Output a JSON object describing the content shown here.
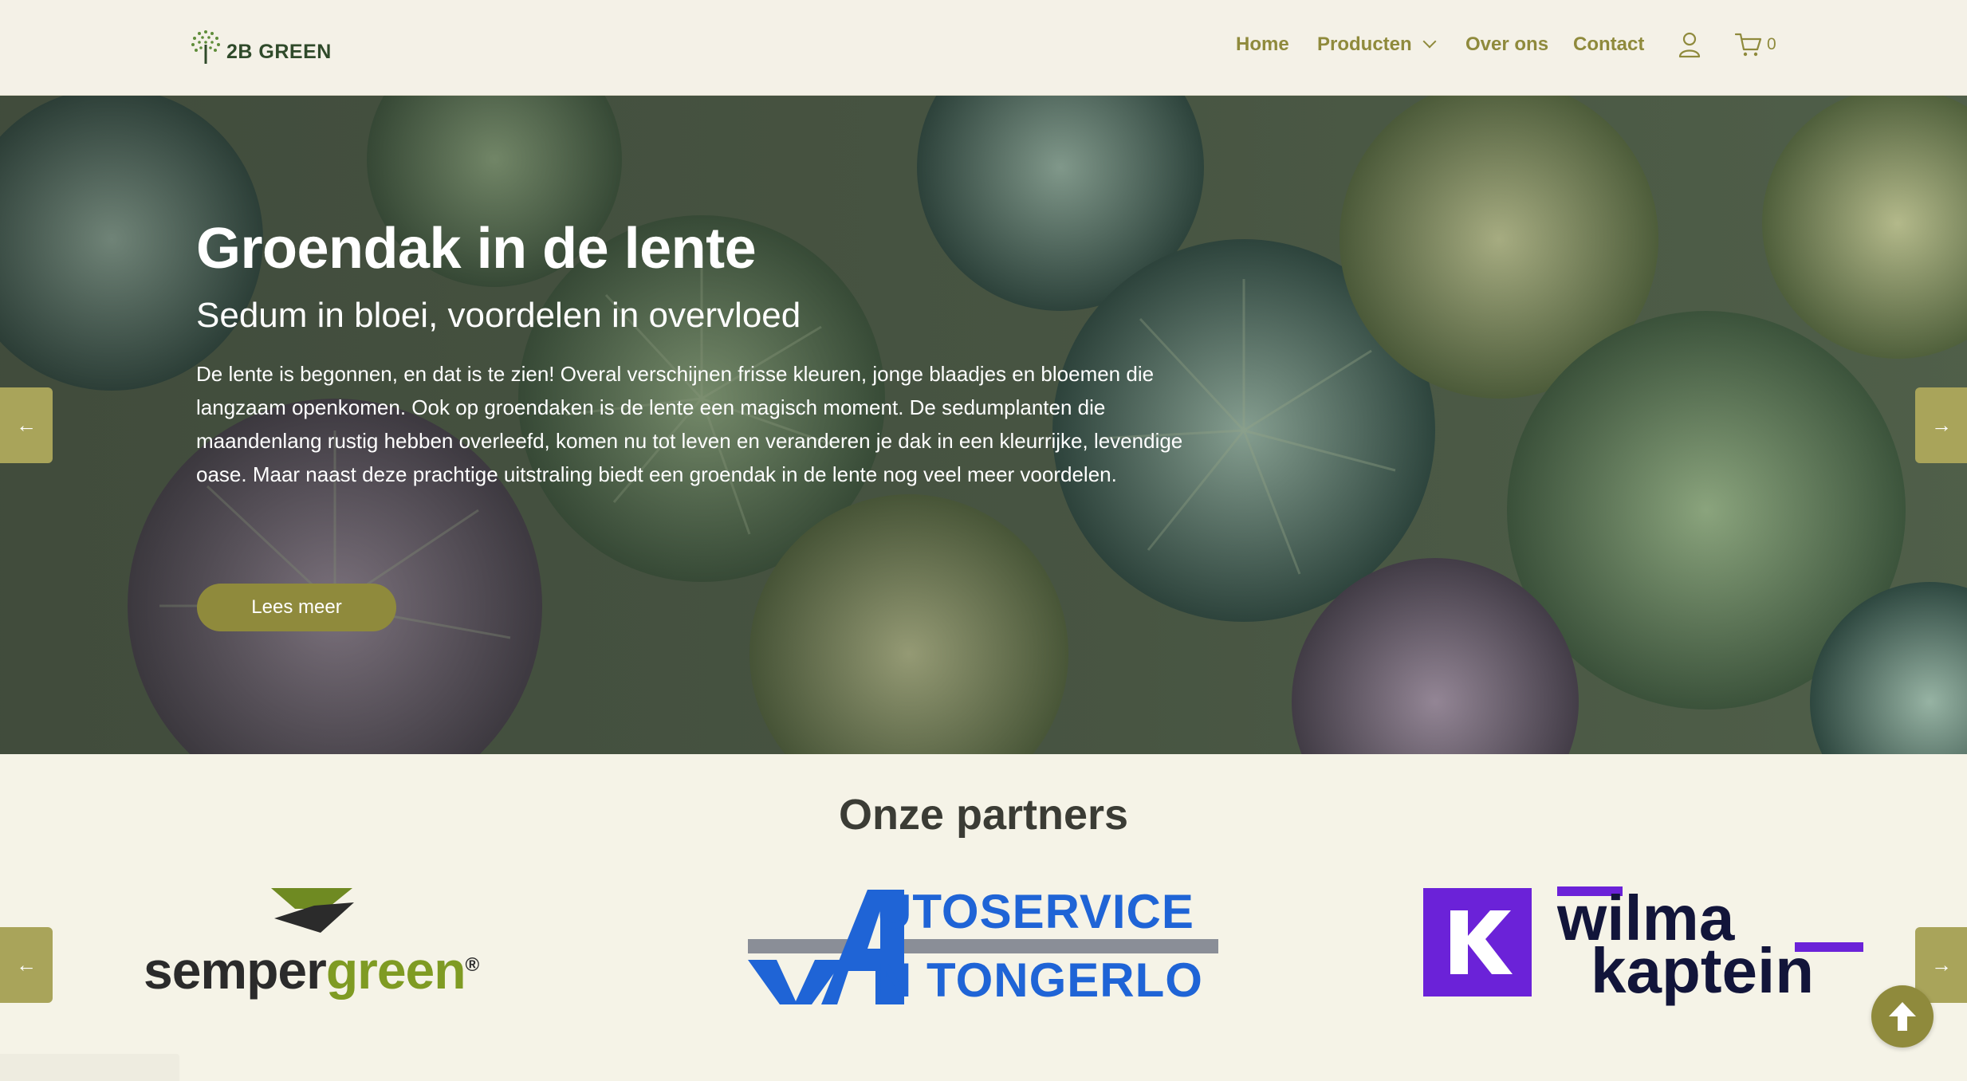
{
  "header": {
    "logo_text": "2B GREEN",
    "nav": [
      {
        "label": "Home"
      },
      {
        "label": "Producten"
      },
      {
        "label": "Over ons"
      },
      {
        "label": "Contact"
      }
    ],
    "account_icon": "user-icon",
    "cart_icon": "cart-icon",
    "cart_count": "0"
  },
  "hero": {
    "title": "Groendak in de lente",
    "subtitle": "Sedum in bloei, voordelen in overvloed",
    "body": "De lente is begonnen, en dat is te zien! Overal verschijnen frisse kleuren, jonge blaadjes en bloemen die langzaam openkomen. Ook op groendaken is de lente een magisch moment. De sedumplanten die maandenlang rustig hebben overleefd, komen nu tot leven en veranderen je dak in een kleurrijke, levendige oase. Maar naast deze prachtige uitstraling biedt een groendak in de lente nog veel meer voordelen.",
    "button": "Lees meer",
    "prev_arrow": "←",
    "next_arrow": "→"
  },
  "partners": {
    "title": "Onze partners",
    "prev_arrow": "←",
    "next_arrow": "→",
    "logos": [
      {
        "name": "sempergreen",
        "text_dark": "semper",
        "text_green": "green",
        "mark": "®"
      },
      {
        "name": "autoservice-van-tongerlo",
        "line1": "UTOSERVICE",
        "line2": "N TONGERLO"
      },
      {
        "name": "wilma-kaptein",
        "line1": "wilma",
        "line2": "kaptein"
      }
    ]
  },
  "colors": {
    "accent": "#8f8a3c",
    "background": "#f5f3e7",
    "logo_green": "#2f4a2a"
  }
}
